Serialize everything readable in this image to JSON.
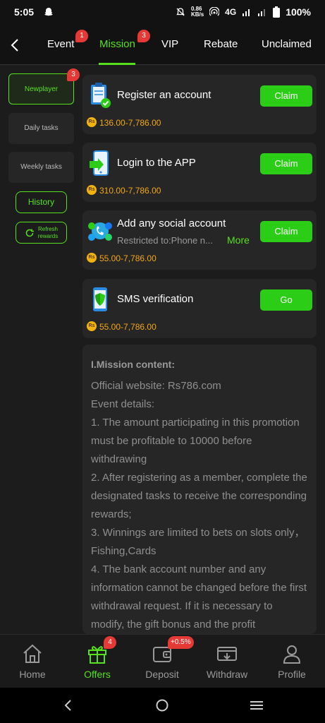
{
  "status": {
    "time": "5:05",
    "net_speed": "0.86",
    "net_unit": "KB/s",
    "network": "4G",
    "battery": "100%"
  },
  "tabs": [
    {
      "label": "Event",
      "badge": "1"
    },
    {
      "label": "Mission",
      "badge": "3"
    },
    {
      "label": "VIP"
    },
    {
      "label": "Rebate"
    },
    {
      "label": "Unclaimed"
    }
  ],
  "sidebar": {
    "items": [
      {
        "label": "Newplayer",
        "badge": "3"
      },
      {
        "label": "Daily tasks"
      },
      {
        "label": "Weekly tasks"
      }
    ],
    "history_label": "History",
    "refresh_label_1": "Refresh",
    "refresh_label_2": "rewards"
  },
  "tasks": [
    {
      "title": "Register an account",
      "reward": "136.00-7,786.00",
      "action": "Claim",
      "icon": "clipboard-check-icon"
    },
    {
      "title": "Login to the APP",
      "reward": "310.00-7,786.00",
      "action": "Claim",
      "icon": "phone-login-icon"
    },
    {
      "title": "Add any social account",
      "subtitle": "Restricted to:Phone n...",
      "more": "More",
      "reward": "55.00-7,786.00",
      "action": "Claim",
      "icon": "social-icon"
    },
    {
      "title": "SMS verification",
      "reward": "55.00-7,786.00",
      "action": "Go",
      "icon": "sms-shield-icon"
    }
  ],
  "coin_symbol": "Rs",
  "mission_content": {
    "heading": "I.Mission content:",
    "lines": [
      "Official website: Rs786.com",
      "Event details:",
      "1. The amount participating in this promotion must be profitable to 10000 before withdrawing",
      "2. After registering as a member, complete the designated tasks to receive the corresponding rewards;",
      "3. Winnings are limited to bets on slots only，Fishing,Cards",
      "4. The bank account number and any information cannot be changed before the first withdrawal request. If it is necessary to modify, the gift bonus and the profit"
    ]
  },
  "bottom_nav": [
    {
      "label": "Home",
      "icon": "home-icon"
    },
    {
      "label": "Offers",
      "icon": "gift-icon",
      "badge": "4"
    },
    {
      "label": "Deposit",
      "icon": "wallet-icon",
      "badge": "+0.5%"
    },
    {
      "label": "Withdraw",
      "icon": "withdraw-icon"
    },
    {
      "label": "Profile",
      "icon": "profile-icon"
    }
  ],
  "colors": {
    "accent": "#58e01e",
    "button": "#2ccd17",
    "reward": "#f3a613",
    "badge": "#e53935"
  }
}
